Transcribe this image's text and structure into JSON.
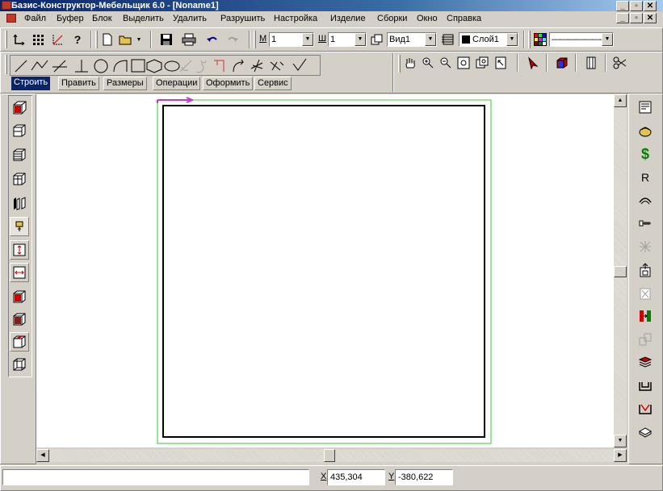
{
  "window": {
    "title": "Базис-Конструктор-Мебельщик 6.0 - [Noname1]",
    "caption_min": "_",
    "caption_restore": "▫",
    "caption_close": "✕"
  },
  "menu": {
    "items": [
      "Файл",
      "Буфер",
      "Блок",
      "Выделить",
      "Удалить",
      "Разрушить",
      "Настройка",
      "Изделие",
      "Сборки",
      "Окно",
      "Справка"
    ]
  },
  "toolbar": {
    "help_label": "?",
    "m_label": "М",
    "m_value": "1",
    "w_label": "Ш",
    "w_value": "1",
    "view_value": "Вид1",
    "layer_value": "Слой1",
    "layer_color": "#000000",
    "line_style_value": "———————"
  },
  "tabs": [
    "Строить",
    "Править",
    "Размеры",
    "Операции",
    "Оформить",
    "Сервис"
  ],
  "active_tab": "Строить",
  "right_toolbar": {
    "dollar_label": "$",
    "r_label": "R"
  },
  "status": {
    "message": "",
    "x_label": "X",
    "x_value": "435,304",
    "y_label": "Y",
    "y_value": "-380,622"
  },
  "colors": {
    "title_bar": "#0a246a",
    "selection_frame": "#33cc33",
    "axis_arrow": "#cc33cc",
    "active_tab": "#0a246a"
  }
}
